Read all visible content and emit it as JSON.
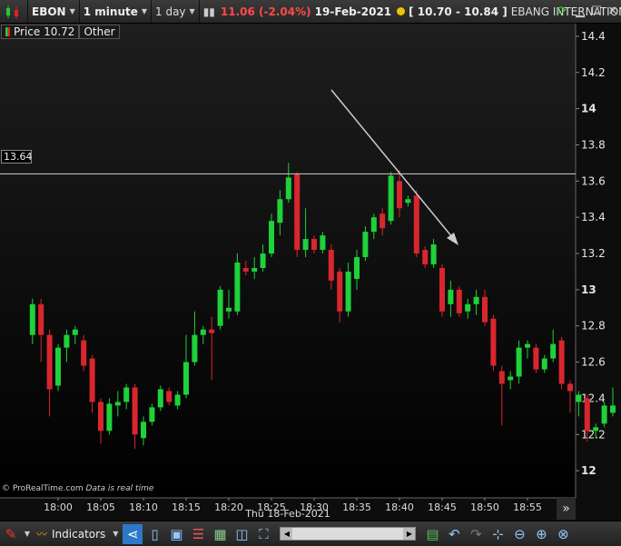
{
  "toolbar": {
    "symbol": "EBON",
    "interval": "1 minute",
    "period": "1 day",
    "quote": "11.06 (-2.04%)",
    "quote_date": "19-Feb-2021",
    "range": "[ 10.70 - 10.84 ]",
    "instrument_name": "EBANG INTERNATIONAL"
  },
  "legend": {
    "price_label": "Price 10.72",
    "other_label": "Other"
  },
  "level_label": "13.64",
  "watermark": {
    "site": "© ProRealTime.com",
    "note": "Data is real time"
  },
  "bottom": {
    "indicators_label": "Indicators",
    "more_glyph": "»"
  },
  "colors": {
    "up": "#1fd13a",
    "down": "#d9262e",
    "level_line": "#cfcfcf",
    "arrow": "#cccccc"
  },
  "chart_data": {
    "type": "candlestick",
    "x_date_label": "Thu 18-Feb-2021",
    "x_ticks": [
      "18:00",
      "18:05",
      "18:10",
      "18:15",
      "18:20",
      "18:25",
      "18:30",
      "18:35",
      "18:40",
      "18:45",
      "18:50",
      "18:55"
    ],
    "y_ticks": [
      12,
      12.2,
      12.4,
      12.6,
      12.8,
      13,
      13.2,
      13.4,
      13.6,
      13.8,
      14,
      14.2,
      14.4
    ],
    "ylim": [
      11.85,
      14.47
    ],
    "horizontal_level": 13.64,
    "candles": [
      {
        "t": "17:57",
        "o": 12.75,
        "h": 12.95,
        "l": 12.7,
        "c": 12.92
      },
      {
        "t": "17:58",
        "o": 12.92,
        "h": 12.95,
        "l": 12.6,
        "c": 12.75
      },
      {
        "t": "17:59",
        "o": 12.75,
        "h": 12.78,
        "l": 12.3,
        "c": 12.45
      },
      {
        "t": "18:00",
        "o": 12.47,
        "h": 12.7,
        "l": 12.44,
        "c": 12.68
      },
      {
        "t": "18:01",
        "o": 12.68,
        "h": 12.78,
        "l": 12.6,
        "c": 12.75
      },
      {
        "t": "18:02",
        "o": 12.75,
        "h": 12.8,
        "l": 12.7,
        "c": 12.78
      },
      {
        "t": "18:03",
        "o": 12.72,
        "h": 12.75,
        "l": 12.55,
        "c": 12.58
      },
      {
        "t": "18:04",
        "o": 12.62,
        "h": 12.64,
        "l": 12.32,
        "c": 12.38
      },
      {
        "t": "18:05",
        "o": 12.38,
        "h": 12.4,
        "l": 12.15,
        "c": 12.22
      },
      {
        "t": "18:06",
        "o": 12.22,
        "h": 12.4,
        "l": 12.2,
        "c": 12.37
      },
      {
        "t": "18:07",
        "o": 12.36,
        "h": 12.44,
        "l": 12.3,
        "c": 12.38
      },
      {
        "t": "18:08",
        "o": 12.38,
        "h": 12.48,
        "l": 12.34,
        "c": 12.46
      },
      {
        "t": "18:09",
        "o": 12.46,
        "h": 12.48,
        "l": 12.12,
        "c": 12.2
      },
      {
        "t": "18:10",
        "o": 12.18,
        "h": 12.3,
        "l": 12.14,
        "c": 12.27
      },
      {
        "t": "18:11",
        "o": 12.27,
        "h": 12.37,
        "l": 12.25,
        "c": 12.35
      },
      {
        "t": "18:12",
        "o": 12.35,
        "h": 12.47,
        "l": 12.33,
        "c": 12.45
      },
      {
        "t": "18:13",
        "o": 12.44,
        "h": 12.46,
        "l": 12.36,
        "c": 12.38
      },
      {
        "t": "18:14",
        "o": 12.36,
        "h": 12.44,
        "l": 12.34,
        "c": 12.42
      },
      {
        "t": "18:15",
        "o": 12.42,
        "h": 12.75,
        "l": 12.4,
        "c": 12.6
      },
      {
        "t": "18:16",
        "o": 12.6,
        "h": 12.88,
        "l": 12.58,
        "c": 12.75
      },
      {
        "t": "18:17",
        "o": 12.75,
        "h": 12.8,
        "l": 12.7,
        "c": 12.78
      },
      {
        "t": "18:18",
        "o": 12.78,
        "h": 12.85,
        "l": 12.5,
        "c": 12.76
      },
      {
        "t": "18:19",
        "o": 12.8,
        "h": 13.02,
        "l": 12.78,
        "c": 13.0
      },
      {
        "t": "18:20",
        "o": 12.88,
        "h": 13.0,
        "l": 12.84,
        "c": 12.9
      },
      {
        "t": "18:21",
        "o": 12.88,
        "h": 13.2,
        "l": 12.86,
        "c": 13.15
      },
      {
        "t": "18:22",
        "o": 13.12,
        "h": 13.16,
        "l": 13.08,
        "c": 13.1
      },
      {
        "t": "18:23",
        "o": 13.1,
        "h": 13.18,
        "l": 13.06,
        "c": 13.12
      },
      {
        "t": "18:24",
        "o": 13.12,
        "h": 13.25,
        "l": 13.1,
        "c": 13.2
      },
      {
        "t": "18:25",
        "o": 13.2,
        "h": 13.42,
        "l": 13.18,
        "c": 13.38
      },
      {
        "t": "18:26",
        "o": 13.37,
        "h": 13.55,
        "l": 13.3,
        "c": 13.5
      },
      {
        "t": "18:27",
        "o": 13.5,
        "h": 13.7,
        "l": 13.48,
        "c": 13.62
      },
      {
        "t": "18:28",
        "o": 13.64,
        "h": 13.65,
        "l": 13.18,
        "c": 13.22
      },
      {
        "t": "18:29",
        "o": 13.22,
        "h": 13.45,
        "l": 13.18,
        "c": 13.28
      },
      {
        "t": "18:30",
        "o": 13.28,
        "h": 13.3,
        "l": 13.2,
        "c": 13.22
      },
      {
        "t": "18:31",
        "o": 13.22,
        "h": 13.32,
        "l": 13.2,
        "c": 13.3
      },
      {
        "t": "18:32",
        "o": 13.22,
        "h": 13.25,
        "l": 13.0,
        "c": 13.05
      },
      {
        "t": "18:33",
        "o": 13.1,
        "h": 13.12,
        "l": 12.82,
        "c": 12.88
      },
      {
        "t": "18:34",
        "o": 12.88,
        "h": 13.15,
        "l": 12.85,
        "c": 13.1
      },
      {
        "t": "18:35",
        "o": 13.06,
        "h": 13.22,
        "l": 13.0,
        "c": 13.18
      },
      {
        "t": "18:36",
        "o": 13.18,
        "h": 13.35,
        "l": 13.16,
        "c": 13.32
      },
      {
        "t": "18:37",
        "o": 13.32,
        "h": 13.42,
        "l": 13.28,
        "c": 13.4
      },
      {
        "t": "18:38",
        "o": 13.42,
        "h": 13.45,
        "l": 13.3,
        "c": 13.34
      },
      {
        "t": "18:39",
        "o": 13.38,
        "h": 13.65,
        "l": 13.36,
        "c": 13.63
      },
      {
        "t": "18:40",
        "o": 13.6,
        "h": 13.66,
        "l": 13.4,
        "c": 13.45
      },
      {
        "t": "18:41",
        "o": 13.48,
        "h": 13.52,
        "l": 13.46,
        "c": 13.5
      },
      {
        "t": "18:42",
        "o": 13.52,
        "h": 13.55,
        "l": 13.18,
        "c": 13.2
      },
      {
        "t": "18:43",
        "o": 13.22,
        "h": 13.24,
        "l": 13.12,
        "c": 13.14
      },
      {
        "t": "18:44",
        "o": 13.14,
        "h": 13.28,
        "l": 13.12,
        "c": 13.25
      },
      {
        "t": "18:45",
        "o": 13.12,
        "h": 13.14,
        "l": 12.85,
        "c": 12.88
      },
      {
        "t": "18:46",
        "o": 12.92,
        "h": 13.05,
        "l": 12.85,
        "c": 13.0
      },
      {
        "t": "18:47",
        "o": 13.0,
        "h": 13.02,
        "l": 12.85,
        "c": 12.87
      },
      {
        "t": "18:48",
        "o": 12.88,
        "h": 12.95,
        "l": 12.84,
        "c": 12.92
      },
      {
        "t": "18:49",
        "o": 12.92,
        "h": 13.0,
        "l": 12.86,
        "c": 12.96
      },
      {
        "t": "18:50",
        "o": 12.96,
        "h": 13.0,
        "l": 12.8,
        "c": 12.82
      },
      {
        "t": "18:51",
        "o": 12.84,
        "h": 12.86,
        "l": 12.55,
        "c": 12.58
      },
      {
        "t": "18:52",
        "o": 12.55,
        "h": 12.58,
        "l": 12.25,
        "c": 12.48
      },
      {
        "t": "18:53",
        "o": 12.5,
        "h": 12.55,
        "l": 12.45,
        "c": 12.52
      },
      {
        "t": "18:54",
        "o": 12.52,
        "h": 12.72,
        "l": 12.48,
        "c": 12.68
      },
      {
        "t": "18:55",
        "o": 12.68,
        "h": 12.72,
        "l": 12.62,
        "c": 12.7
      },
      {
        "t": "18:56",
        "o": 12.68,
        "h": 12.7,
        "l": 12.54,
        "c": 12.56
      },
      {
        "t": "18:57",
        "o": 12.56,
        "h": 12.64,
        "l": 12.54,
        "c": 12.62
      },
      {
        "t": "18:58",
        "o": 12.62,
        "h": 12.78,
        "l": 12.6,
        "c": 12.7
      },
      {
        "t": "18:59",
        "o": 12.72,
        "h": 12.74,
        "l": 12.45,
        "c": 12.48
      },
      {
        "t": "19:00",
        "o": 12.48,
        "h": 12.5,
        "l": 12.32,
        "c": 12.44
      },
      {
        "t": "19:01",
        "o": 12.38,
        "h": 12.44,
        "l": 12.3,
        "c": 12.42
      },
      {
        "t": "19:02",
        "o": 12.4,
        "h": 12.42,
        "l": 12.16,
        "c": 12.22
      },
      {
        "t": "19:03",
        "o": 12.22,
        "h": 12.26,
        "l": 12.18,
        "c": 12.24
      },
      {
        "t": "19:04",
        "o": 12.26,
        "h": 12.38,
        "l": 12.24,
        "c": 12.36
      },
      {
        "t": "19:05",
        "o": 12.32,
        "h": 12.46,
        "l": 12.3,
        "c": 12.36
      }
    ]
  }
}
